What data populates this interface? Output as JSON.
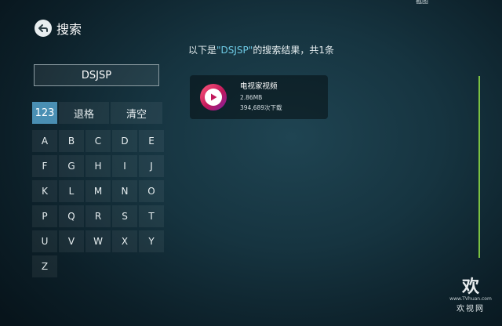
{
  "topbar": {
    "text": "截图"
  },
  "header": {
    "title": "搜索",
    "back_icon": "back-arrow-icon"
  },
  "search": {
    "value": "DSJSP"
  },
  "keyboard": {
    "function_keys": [
      "123",
      "退格",
      "清空"
    ],
    "letters": [
      "A",
      "B",
      "C",
      "D",
      "E",
      "F",
      "G",
      "H",
      "I",
      "J",
      "K",
      "L",
      "M",
      "N",
      "O",
      "P",
      "Q",
      "R",
      "S",
      "T",
      "U",
      "V",
      "W",
      "X",
      "Y",
      "Z"
    ]
  },
  "results": {
    "prefix": "以下是",
    "keyword": "\"DSJSP\"",
    "suffix": "的搜索结果，共1条",
    "items": [
      {
        "name": "电视家视频",
        "size": "2.86MB",
        "downloads": "394,689次下载",
        "icon": "play-icon"
      }
    ]
  },
  "watermark": {
    "logo": "欢",
    "url": "www.TVhuan.com",
    "text": "欢视网"
  },
  "colors": {
    "selected_key": "#4a8fb3",
    "scrollbar": "#7bc143",
    "keyword": "#6ecbe6"
  }
}
